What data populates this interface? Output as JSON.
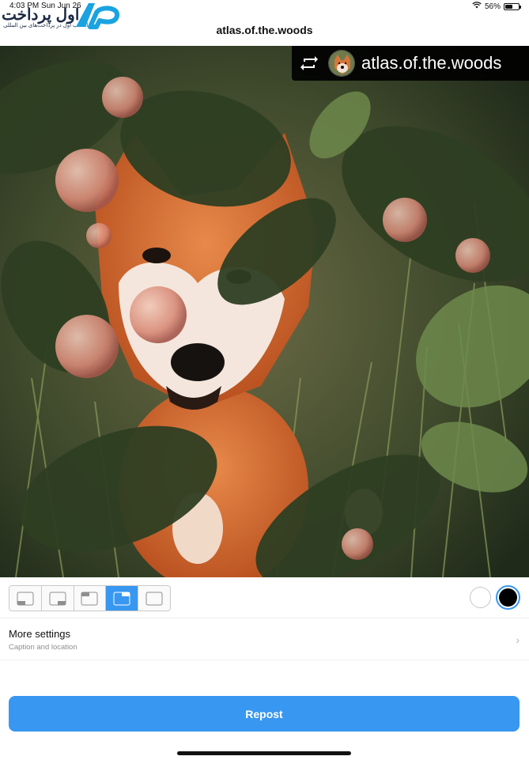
{
  "status_bar": {
    "time": "4:03 PM   Sun Jun 26",
    "battery": "56%",
    "battery_level": 0.56,
    "icons": [
      "wifi-icon",
      "battery-icon"
    ]
  },
  "watermark": {
    "text": "اول پرداخت",
    "subtitle": "انتخاب اول در پرداخت‌های بین المللی",
    "logo": "ap-logo",
    "color": "#1c2a44",
    "accent": "#1aa3e0"
  },
  "header": {
    "title": "atlas.of.the.woods"
  },
  "photo": {
    "attribution_user": "atlas.of.the.woods",
    "icons": [
      "repost-icon",
      "avatar"
    ]
  },
  "toolbar": {
    "position_options": [
      "bottom-left",
      "bottom-right",
      "top-left",
      "top-right",
      "none"
    ],
    "selected_position": "top-right",
    "colors": [
      "#ffffff",
      "#000000"
    ],
    "selected_color": "#000000"
  },
  "settings": {
    "title": "More settings",
    "subtitle": "Caption and location",
    "icon": "chevron-right-icon"
  },
  "actions": {
    "repost_label": "Repost"
  },
  "theme": {
    "accent": "#3897f0",
    "text": "#111111",
    "muted": "#8e8e8e"
  }
}
